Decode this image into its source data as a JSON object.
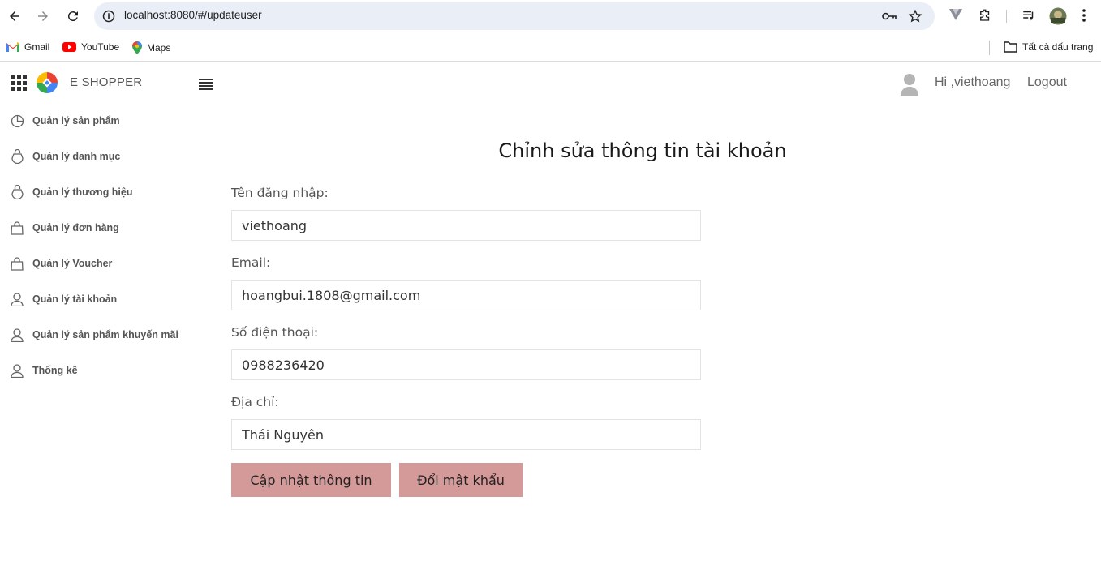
{
  "browser": {
    "url": "localhost:8080/#/updateuser",
    "bookmarks": [
      {
        "label": "Gmail",
        "icon": "gmail-icon"
      },
      {
        "label": "YouTube",
        "icon": "youtube-icon"
      },
      {
        "label": "Maps",
        "icon": "maps-icon"
      }
    ],
    "all_bookmarks_label": "Tất cả dấu trang"
  },
  "header": {
    "brand": "E SHOPPER",
    "greeting": "Hi ,viethoang",
    "logout": "Logout"
  },
  "sidebar": {
    "items": [
      {
        "label": "Quản lý sản phẩm",
        "icon": "pie-chart-icon"
      },
      {
        "label": "Quản lý danh mục",
        "icon": "bag-icon"
      },
      {
        "label": "Quản lý thương hiệu",
        "icon": "bag-icon"
      },
      {
        "label": "Quản lý đơn hàng",
        "icon": "shopping-bag-icon"
      },
      {
        "label": "Quản lý Voucher",
        "icon": "shopping-bag-icon"
      },
      {
        "label": "Quản lý tài khoản",
        "icon": "user-icon"
      },
      {
        "label": "Quản lý sản phẩm khuyến mãi",
        "icon": "user-icon"
      },
      {
        "label": "Thống kê",
        "icon": "user-icon"
      }
    ]
  },
  "form": {
    "title": "Chỉnh sửa thông tin tài khoản",
    "username_label": "Tên đăng nhập:",
    "username_value": "viethoang",
    "email_label": "Email:",
    "email_value": "hoangbui.1808@gmail.com",
    "phone_label": "Số điện thoại:",
    "phone_value": "0988236420",
    "address_label": "Địa chỉ:",
    "address_value": "Thái Nguyên",
    "update_button": "Cập nhật thông tin",
    "change_password_button": "Đổi mật khẩu"
  },
  "colors": {
    "button_bg": "#d49a99",
    "omnibox_bg": "#e9eef7"
  }
}
